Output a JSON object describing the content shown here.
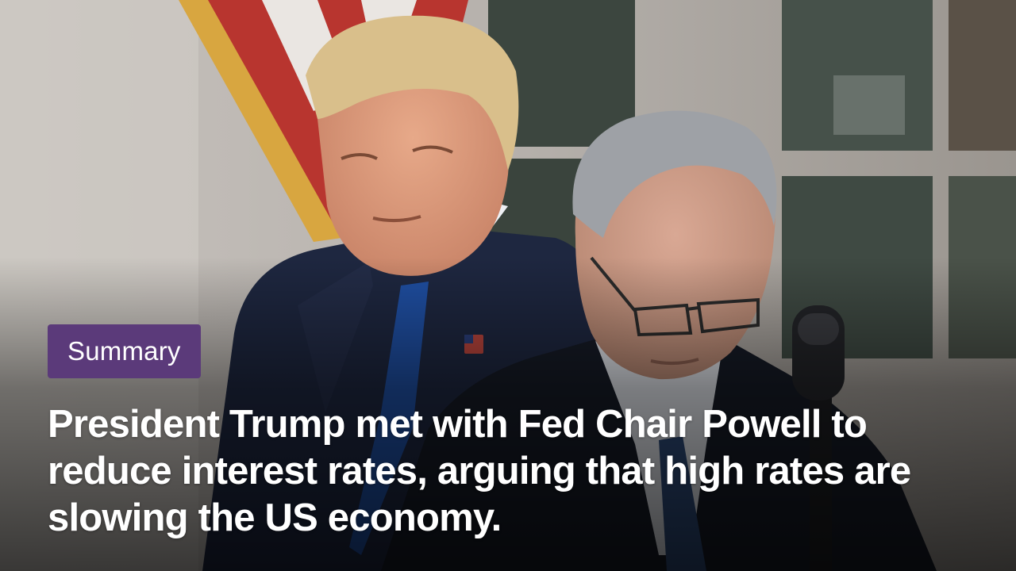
{
  "card": {
    "badge_label": "Summary",
    "headline": "President Trump met with Fed Chair Powell to reduce interest rates, arguing that high rates are slowing the US economy."
  },
  "colors": {
    "badge_background": "#5b3a7a",
    "text": "#ffffff"
  },
  "photo": {
    "subject": "news-photo-trump-and-powell"
  }
}
